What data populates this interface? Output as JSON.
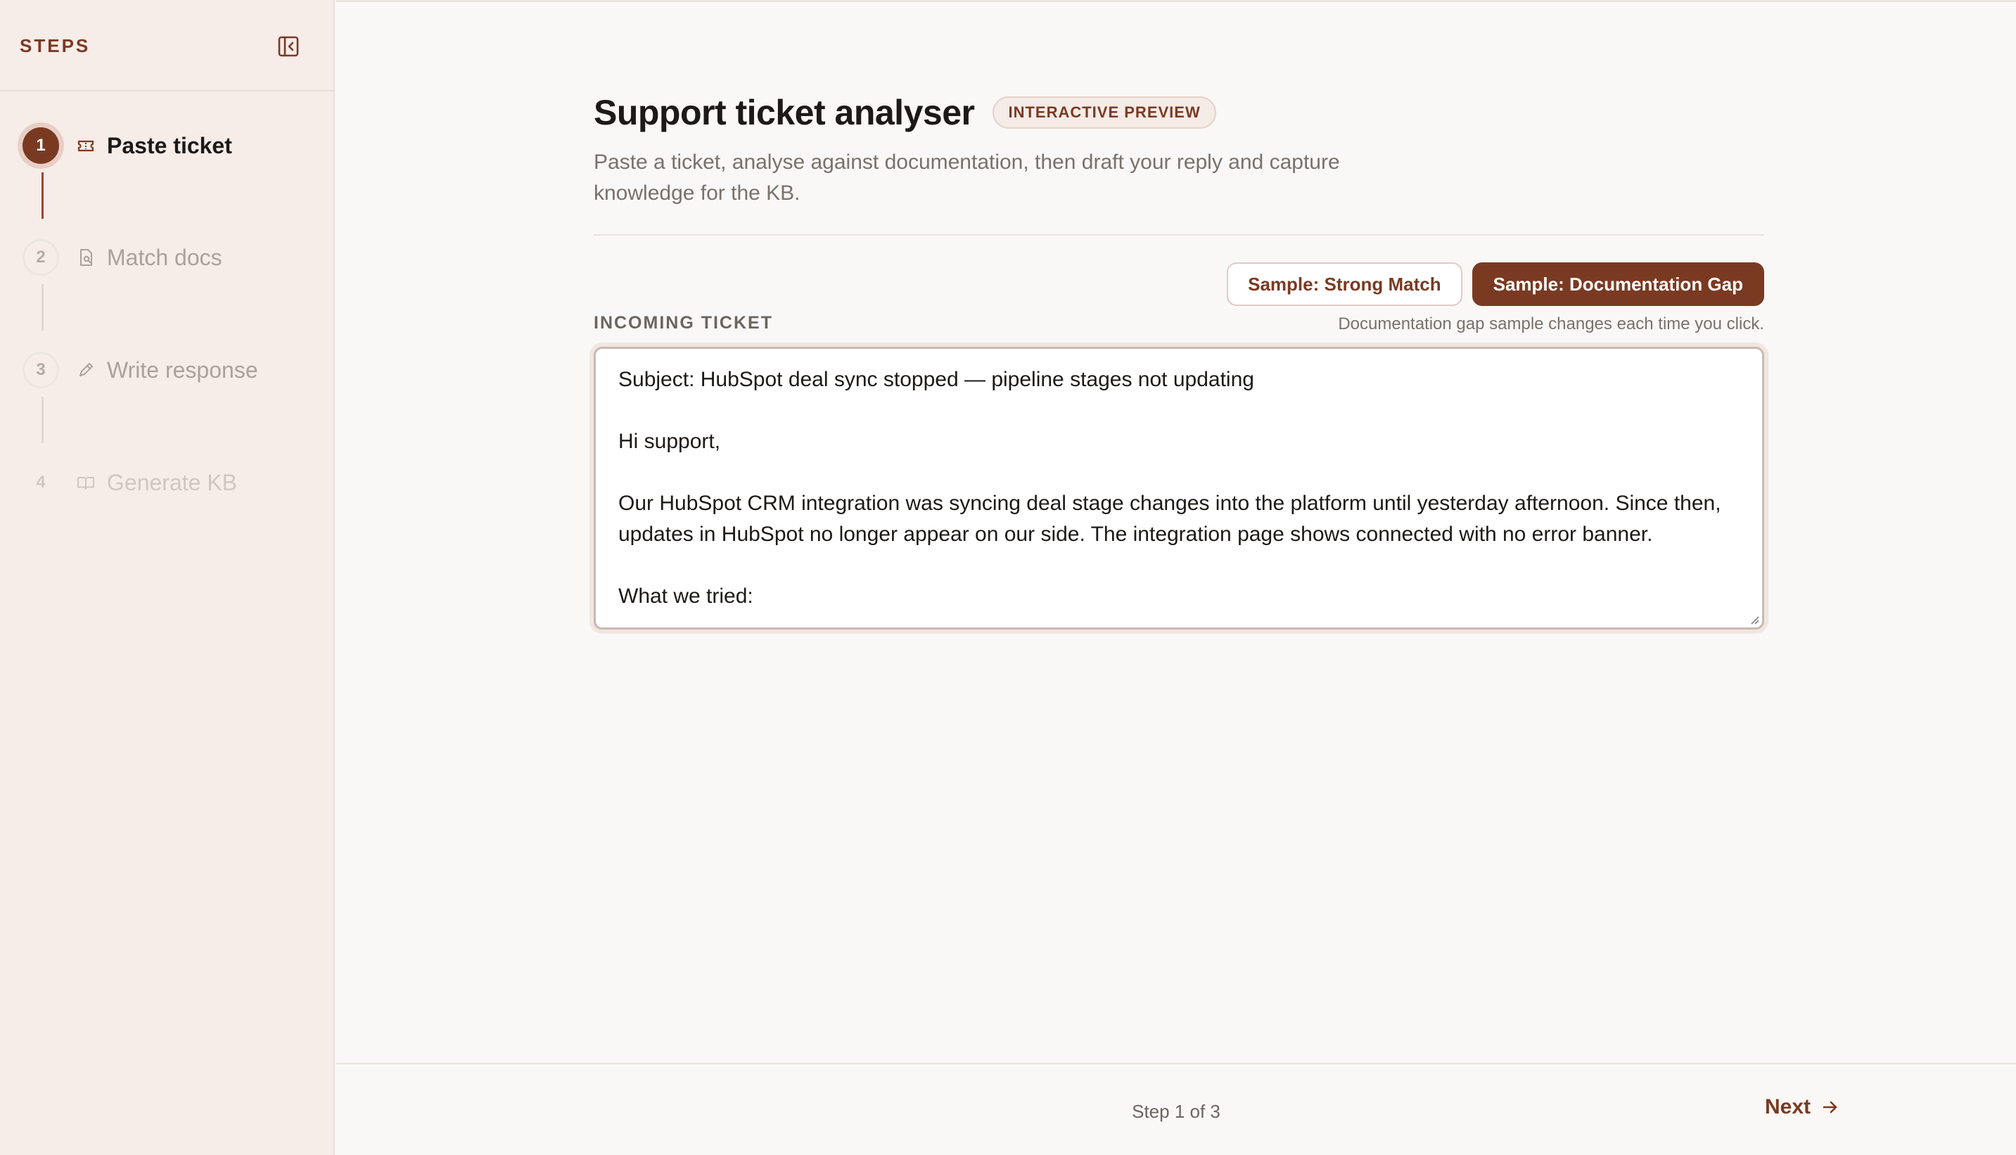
{
  "sidebar": {
    "title": "STEPS",
    "collapse_icon": "panel-collapse-icon",
    "steps": [
      {
        "number": "1",
        "label": "Paste ticket",
        "icon": "ticket-icon",
        "state": "active"
      },
      {
        "number": "2",
        "label": "Match docs",
        "icon": "file-search-icon",
        "state": "pending"
      },
      {
        "number": "3",
        "label": "Write response",
        "icon": "pencil-icon",
        "state": "pending"
      },
      {
        "number": "4",
        "label": "Generate KB",
        "icon": "book-icon",
        "state": "pending"
      }
    ]
  },
  "header": {
    "title": "Support ticket analyser",
    "badge": "INTERACTIVE PREVIEW",
    "subtitle": "Paste a ticket, analyse against documentation, then draft your reply and capture knowledge for the KB."
  },
  "samples": {
    "strong_match_label": "Sample: Strong Match",
    "doc_gap_label": "Sample: Documentation Gap",
    "hint": "Documentation gap sample changes each time you click."
  },
  "ticket": {
    "label": "INCOMING TICKET",
    "value": "Subject: HubSpot deal sync stopped — pipeline stages not updating\n\nHi support,\n\nOur HubSpot CRM integration was syncing deal stage changes into the platform until yesterday afternoon. Since then, updates in HubSpot no longer appear on our side. The integration page shows connected with no error banner.\n\nWhat we tried:"
  },
  "footer": {
    "step_counter": "Step 1 of 3",
    "next_label": "Next"
  },
  "colors": {
    "accent": "#7a3a22",
    "sidebar_bg": "#f6ece8",
    "page_bg": "#f9f8f6"
  }
}
